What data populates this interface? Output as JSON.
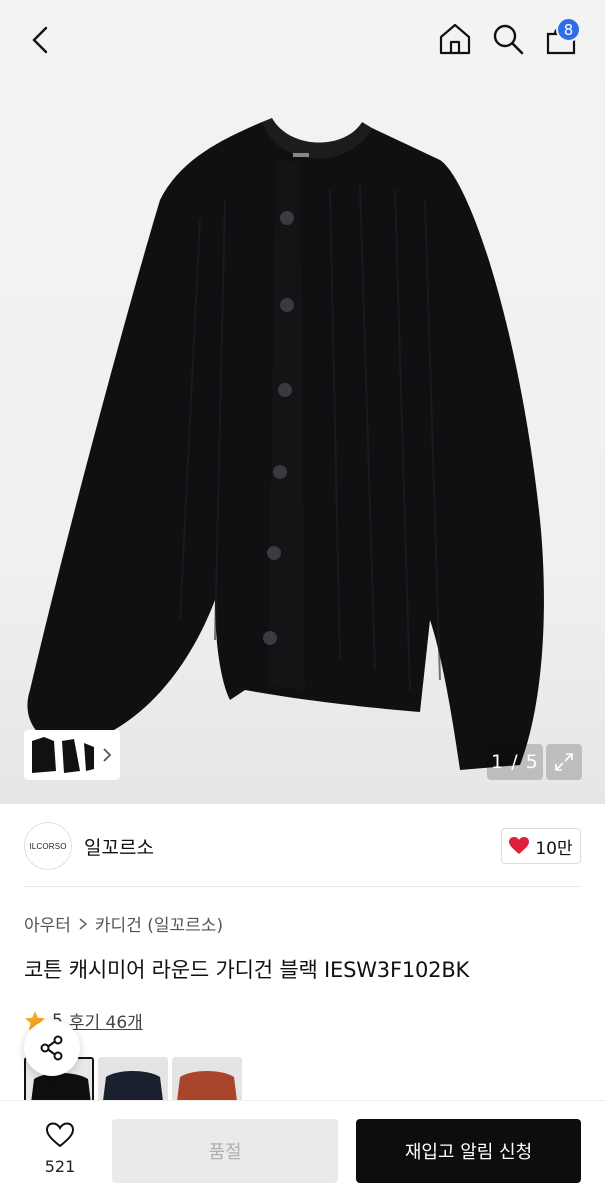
{
  "header": {
    "cart_count": "8",
    "icons": [
      "back-icon",
      "home-icon",
      "search-icon",
      "shopping-bag-icon"
    ]
  },
  "gallery": {
    "counter": "1 / 5"
  },
  "brand": {
    "logo_text": "ILCORSO",
    "name": "일꼬르소",
    "likes": "10만"
  },
  "breadcrumb": {
    "category": "아우터",
    "subcategory": "카디건 (일꼬르소)"
  },
  "product": {
    "title": "코튼 캐시미어 라운드 가디건 블랙 IESW3F102BK",
    "rating": "5",
    "reviews": "후기 46개"
  },
  "color_options": [
    "black",
    "navy",
    "rust"
  ],
  "bottom": {
    "wish_count": "521",
    "soldout_label": "품절",
    "restock_label": "재입고 알림 신청"
  },
  "colors": {
    "badge": "#2f6ee8",
    "heart": "#e0203a",
    "rating_star": "#f5a623",
    "primary_button": "#0d0d0d"
  }
}
